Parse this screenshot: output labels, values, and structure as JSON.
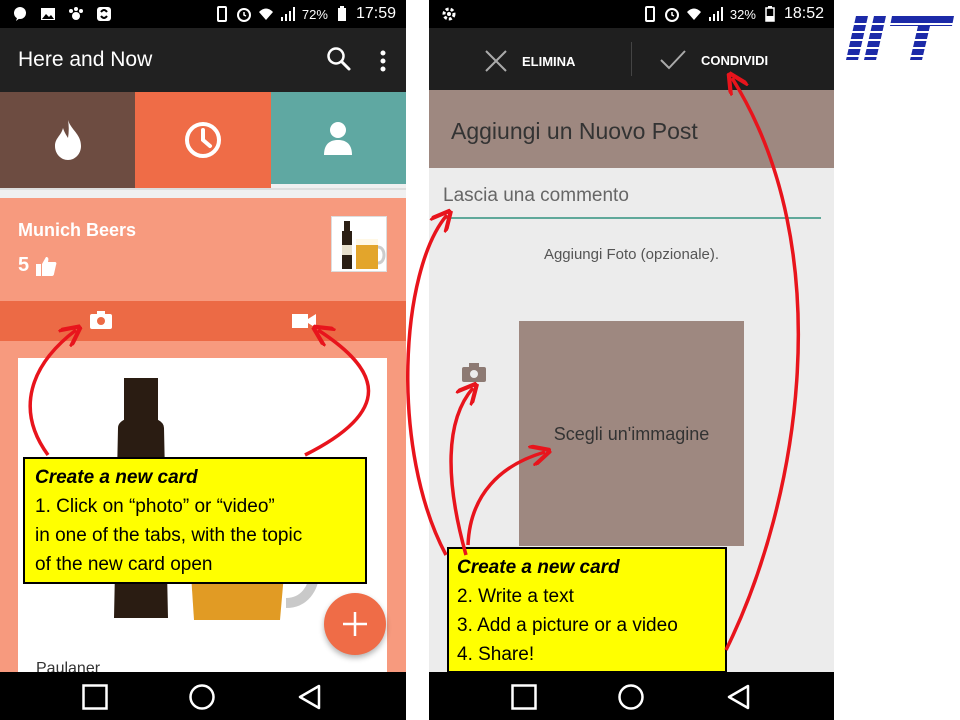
{
  "phone1": {
    "status": {
      "battery": "72%",
      "time": "17:59"
    },
    "appbar": {
      "title": "Here and Now"
    },
    "card": {
      "title": "Munich Beers",
      "likes": "5",
      "caption": "Paulaner"
    }
  },
  "phone2": {
    "status": {
      "battery": "32%",
      "time": "18:52"
    },
    "actions": {
      "delete_label": "ELIMINA",
      "share_label": "CONDIVIDI"
    },
    "header": {
      "title": "Aggiungi un Nuovo Post"
    },
    "comment_placeholder": "Lascia una commento",
    "add_photo_label": "Aggiungi Foto (opzionale).",
    "image_picker_label": "Scegli un'immagine"
  },
  "callout1": {
    "heading": "Create a new card",
    "lines": [
      "1.    Click on “photo” or “video”",
      "in one of the tabs, with the topic",
      "of the new card open"
    ]
  },
  "callout2": {
    "heading": "Create a new card",
    "lines": [
      "2. Write a text",
      "3. Add a picture or a video",
      "4. Share!"
    ]
  },
  "colors": {
    "hot_tab": "#6d4c41",
    "recent_tab": "#ef6c47",
    "profile_tab": "#5fa8a2",
    "card_bg": "#f79a7e",
    "callout_bg": "#ffff00",
    "arrow": "#e8141c",
    "logo_blue": "#1c2aa8"
  },
  "icons": [
    "flame-icon",
    "clock-icon",
    "person-icon",
    "camera-icon",
    "video-icon",
    "thumbs-up-icon",
    "search-icon",
    "more-icon",
    "close-icon",
    "check-icon",
    "plus-icon",
    "back-icon",
    "home-icon",
    "recents-icon"
  ]
}
